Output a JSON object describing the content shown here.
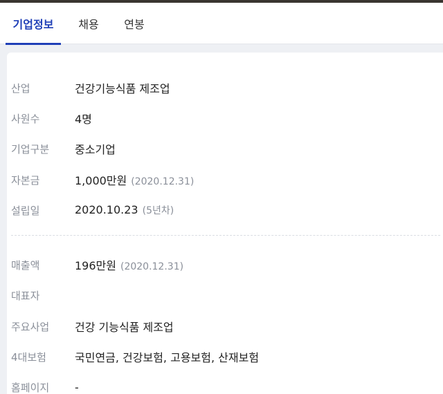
{
  "tabs": [
    {
      "label": "기업정보",
      "active": true
    },
    {
      "label": "채용",
      "active": false
    },
    {
      "label": "연봉",
      "active": false
    }
  ],
  "info": {
    "industry": {
      "label": "산업",
      "value": "건강기능식품 제조업"
    },
    "employees": {
      "label": "사원수",
      "value": "4명"
    },
    "company_type": {
      "label": "기업구분",
      "value": "중소기업"
    },
    "capital": {
      "label": "자본금",
      "value": "1,000만원",
      "note": "(2020.12.31)"
    },
    "founded": {
      "label": "설립일",
      "value": "2020.10.23",
      "note": "(5년차)"
    },
    "revenue": {
      "label": "매출액",
      "value": "196만원",
      "note": "(2020.12.31)"
    },
    "ceo": {
      "label": "대표자",
      "value": ""
    },
    "main_business": {
      "label": "주요사업",
      "value": "건강 기능식품 제조업"
    },
    "insurance": {
      "label": "4대보험",
      "value": "국민연금, 건강보험, 고용보험, 산재보험"
    },
    "homepage": {
      "label": "홈페이지",
      "value": "-"
    }
  },
  "colors": {
    "accent": "#1f3fb7",
    "label_gray": "#8a8f99",
    "page_bg": "#eef0f4"
  }
}
